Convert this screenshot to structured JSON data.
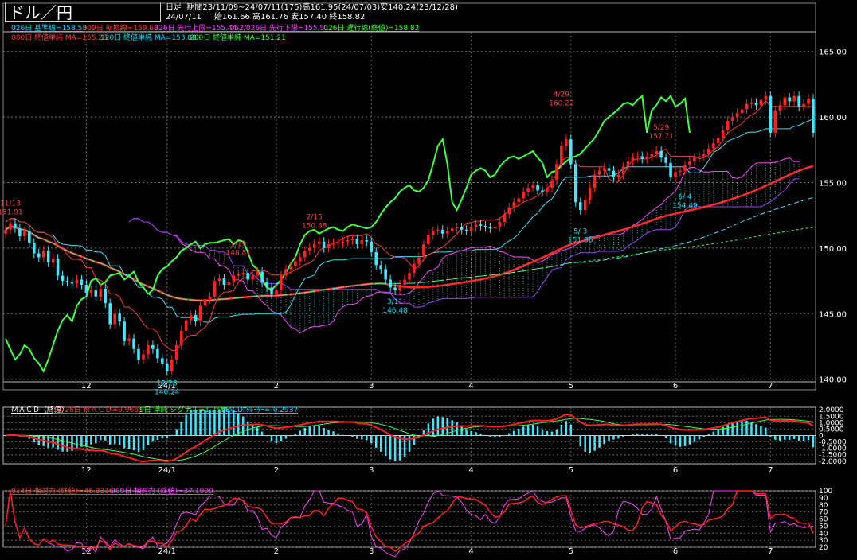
{
  "header": {
    "title": "ドル／円",
    "period": "日足",
    "period_line": "期間23/11/09~24/07/11(175)高161.95(24/07/03)安140.24(23/12/28)",
    "date": "24/07/11",
    "ohlc": "始161.66 高161.76 安157.40 終158.82"
  },
  "legend": {
    "row1": [
      {
        "text": "026日 基準線=158.53",
        "color": "#00e0ff"
      },
      {
        "text": "009日 転換線=159.68",
        "color": "#ff3b3b"
      },
      {
        "text": "026日 先行上限=155.44",
        "color": "#ff40ff"
      },
      {
        "text": "052/026日 先行下限=155.51",
        "color": "#ff40ff"
      },
      {
        "text": "026日 遅行線(終値)=158.82",
        "color": "#40ff40"
      }
    ],
    "row2": [
      {
        "text": "080日 終値単純 MA=155.28",
        "color": "#ff3b3b"
      },
      {
        "text": "120日 終値単純 MA=153.80",
        "color": "#00e0ff"
      },
      {
        "text": "200日 終値単純 MA=151.21",
        "color": "#40ff40"
      }
    ]
  },
  "macd_legend": [
    {
      "text": "ＭＡＣＤ（終値）",
      "color": "#ffffff"
    },
    {
      "text": "12-26日 ＭＡＣＤ=0.9661",
      "color": "#ff3b3b"
    },
    {
      "text": "9日 単純 シグナル=1.2598",
      "color": "#40ff40"
    },
    {
      "text": "MACDｵｼﾚｰﾀｰ=-0.2937",
      "color": "#00e0ff"
    }
  ],
  "rsi_legend": [
    {
      "text": "014日 相対力 (終値)=46.0316",
      "color": "#ff3b3b"
    },
    {
      "text": "009日 相対力 (終値)=37.1999",
      "color": "#ff40ff"
    }
  ],
  "x_labels": [
    {
      "text": "12",
      "i": 17
    },
    {
      "text": "24/1",
      "i": 34
    },
    {
      "text": "2",
      "i": 57
    },
    {
      "text": "3",
      "i": 77
    },
    {
      "text": "4",
      "i": 98
    },
    {
      "text": "5",
      "i": 119
    },
    {
      "text": "6",
      "i": 141
    },
    {
      "text": "7",
      "i": 161
    }
  ],
  "annotations": [
    {
      "text": "11/13",
      "text2": "151.91",
      "i": 1,
      "value": 151.91,
      "color": "#ff3b3b",
      "pos": "above"
    },
    {
      "text": "12/28",
      "text2": "140.24",
      "i": 34,
      "value": 140.24,
      "color": "#00e0ff",
      "pos": "below"
    },
    {
      "text": "1/19",
      "text2": "148.81",
      "i": 49,
      "value": 148.81,
      "color": "#ff3b3b",
      "pos": "above"
    },
    {
      "text": "2/13",
      "text2": "150.88",
      "i": 65,
      "value": 150.88,
      "color": "#ff3b3b",
      "pos": "above"
    },
    {
      "text": "3/11",
      "text2": "146.48",
      "i": 82,
      "value": 146.48,
      "color": "#00e0ff",
      "pos": "below"
    },
    {
      "text": "4/29",
      "text2": "160.22",
      "i": 117,
      "value": 160.22,
      "color": "#ff3b3b",
      "pos": "above"
    },
    {
      "text": "5/ 3",
      "text2": "151.86",
      "i": 121,
      "value": 151.86,
      "color": "#00e0ff",
      "pos": "below"
    },
    {
      "text": "5/29",
      "text2": "157.71",
      "i": 138,
      "value": 157.71,
      "color": "#ff3b3b",
      "pos": "above"
    },
    {
      "text": "6/ 4",
      "text2": "154.49",
      "i": 143,
      "value": 154.49,
      "color": "#00e0ff",
      "pos": "below"
    }
  ],
  "chart_data": {
    "type": "candlestick",
    "count": 175,
    "price_axis": {
      "ticks": [
        140,
        145,
        150,
        155,
        160,
        165
      ],
      "ylim": [
        139.8,
        166.5
      ]
    },
    "macd_axis": {
      "ticks": [
        "2.0000",
        "1.5000",
        "1.0000",
        "0.5000",
        "0",
        "-0.5000",
        "-1.0000",
        "-1.5000",
        "-2.0000"
      ],
      "ylim": [
        -2.2,
        2.2
      ]
    },
    "rsi_axis": {
      "ticks": [
        "100",
        "90",
        "80",
        "70",
        "60",
        "50",
        "40",
        "30",
        "20"
      ],
      "ylim": [
        20,
        100
      ]
    },
    "close": [
      151.4,
      151.9,
      151.5,
      150.9,
      151.3,
      150.4,
      149.6,
      149.3,
      149.8,
      148.9,
      149.2,
      147.9,
      147.5,
      147.4,
      147.3,
      147.6,
      147.2,
      146.6,
      146.8,
      146.3,
      146.9,
      145.8,
      144.2,
      145.0,
      144.4,
      142.9,
      143.1,
      142.3,
      141.5,
      141.9,
      142.6,
      142.3,
      141.6,
      141.2,
      140.6,
      141.5,
      142.6,
      143.7,
      144.5,
      144.9,
      144.4,
      145.6,
      146.1,
      146.3,
      147.5,
      147.7,
      147.2,
      147.4,
      147.9,
      148.0,
      148.1,
      147.6,
      147.9,
      148.2,
      147.4,
      147.0,
      146.5,
      146.8,
      147.9,
      148.4,
      148.6,
      149.0,
      149.3,
      149.8,
      150.0,
      150.3,
      150.5,
      150.0,
      150.3,
      150.4,
      150.4,
      150.5,
      150.6,
      150.7,
      150.3,
      150.6,
      150.5,
      149.7,
      148.7,
      148.4,
      147.6,
      147.0,
      146.8,
      147.2,
      147.6,
      148.1,
      148.8,
      149.3,
      150.3,
      151.0,
      151.3,
      151.4,
      151.1,
      151.3,
      151.5,
      151.6,
      151.4,
      151.3,
      151.6,
      151.8,
      151.7,
      151.6,
      151.5,
      151.6,
      152.0,
      152.6,
      153.1,
      153.5,
      153.8,
      154.3,
      154.6,
      154.8,
      154.4,
      154.3,
      154.6,
      155.2,
      156.4,
      157.8,
      158.3,
      156.4,
      153.5,
      152.9,
      153.7,
      154.6,
      155.6,
      155.9,
      156.1,
      155.9,
      155.4,
      155.6,
      156.2,
      156.6,
      156.9,
      157.0,
      156.8,
      157.0,
      157.2,
      157.4,
      156.9,
      156.5,
      155.4,
      155.8,
      155.9,
      156.3,
      156.6,
      156.9,
      157.0,
      157.2,
      157.6,
      158.0,
      158.4,
      159.0,
      159.7,
      160.0,
      160.3,
      160.6,
      161.0,
      161.1,
      160.9,
      161.3,
      161.6,
      158.8,
      160.5,
      160.9,
      161.5,
      161.2,
      161.6,
      160.8,
      161.0,
      161.4,
      158.8
    ]
  }
}
